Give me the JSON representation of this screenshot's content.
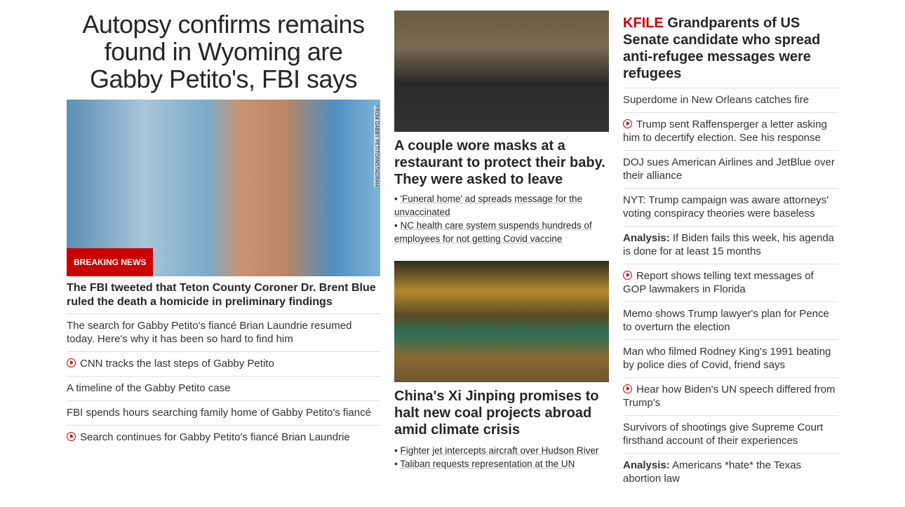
{
  "left": {
    "headline": "Autopsy confirms remains found in Wyoming are Gabby Petito's, FBI says",
    "image_credit": "FROM GABBY PETITO/INSTAGRAM",
    "badge": "BREAKING NEWS",
    "subheadline": "The FBI tweeted that Teton County Coroner Dr. Brent Blue ruled the death a homicide in preliminary findings",
    "links": [
      {
        "text": "The search for Gabby Petito's fiancé Brian Laundrie resumed today. Here's why it has been so hard to find him",
        "video": false
      },
      {
        "text": "CNN tracks the last steps of Gabby Petito",
        "video": true
      },
      {
        "text": "A timeline of the Gabby Petito case",
        "video": false
      },
      {
        "text": "FBI spends hours searching family home of Gabby Petito's fiancé",
        "video": false
      },
      {
        "text": "Search continues for Gabby Petito's fiancé Brian Laundrie",
        "video": true
      }
    ]
  },
  "middle": {
    "story1": {
      "headline": "A couple wore masks at a restaurant to protect their baby. They were asked to leave",
      "links": [
        "'Funeral home' ad spreads message for the unvaccinated",
        "NC health care system suspends hundreds of employees for not getting Covid vaccine"
      ]
    },
    "story2": {
      "headline": "China's Xi Jinping promises to halt new coal projects abroad amid climate crisis",
      "links": [
        "Fighter jet intercepts aircraft over Hudson River",
        "Taliban requests representation at the UN"
      ]
    }
  },
  "right": {
    "kicker": "KFILE",
    "headline": "Grandparents of US Senate candidate who spread anti-refugee messages were refugees",
    "links": [
      {
        "label": "",
        "text": "Superdome in New Orleans catches fire",
        "video": false
      },
      {
        "label": "",
        "text": "Trump sent Raffensperger a letter asking him to decertify election. See his response",
        "video": true
      },
      {
        "label": "",
        "text": "DOJ sues American Airlines and JetBlue over their alliance",
        "video": false
      },
      {
        "label": "",
        "text": "NYT: Trump campaign was aware attorneys' voting conspiracy theories were baseless",
        "video": false
      },
      {
        "label": "Analysis:",
        "text": "If Biden fails this week, his agenda is done for at least 15 months",
        "video": false
      },
      {
        "label": "",
        "text": "Report shows telling text messages of GOP lawmakers in Florida",
        "video": true
      },
      {
        "label": "",
        "text": "Memo shows Trump lawyer's plan for Pence to overturn the election",
        "video": false
      },
      {
        "label": "",
        "text": "Man who filmed Rodney King's 1991 beating by police dies of Covid, friend says",
        "video": false
      },
      {
        "label": "",
        "text": "Hear how Biden's UN speech differed from Trump's",
        "video": true
      },
      {
        "label": "",
        "text": "Survivors of shootings give Supreme Court firsthand account of their experiences",
        "video": false
      },
      {
        "label": "Analysis:",
        "text": "Americans *hate* the Texas abortion law",
        "video": false
      }
    ]
  }
}
